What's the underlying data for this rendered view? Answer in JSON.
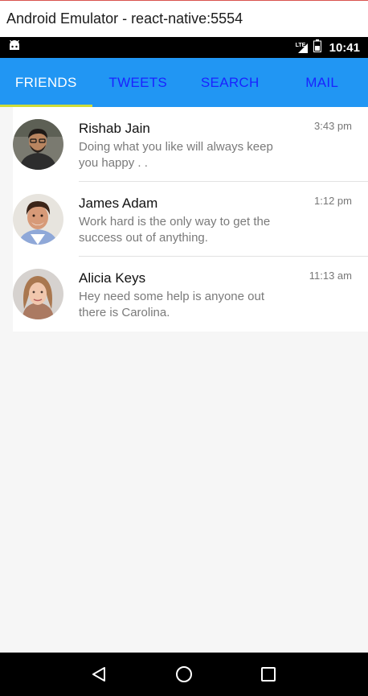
{
  "window": {
    "title": "Android Emulator - react-native:5554"
  },
  "status_bar": {
    "network": "LTE",
    "time": "10:41",
    "icons": [
      "android-debug-icon",
      "signal-icon",
      "battery-icon"
    ]
  },
  "tabs": [
    {
      "label": "FRIENDS",
      "active": true
    },
    {
      "label": "TWEETS",
      "active": false
    },
    {
      "label": "SEARCH",
      "active": false
    },
    {
      "label": "MAIL",
      "active": false
    }
  ],
  "colors": {
    "tabbar": "#2196f3",
    "active_indicator": "#cddc39",
    "inactive_tab_text": "#1a23ff"
  },
  "friends": [
    {
      "name": "Rishab Jain",
      "message": "Doing what you like will always keep you happy . .",
      "time": "3:43 pm"
    },
    {
      "name": "James Adam",
      "message": "Work hard is the only way to get the success out of anything.",
      "time": "1:12 pm"
    },
    {
      "name": "Alicia Keys",
      "message": "Hey need some help is anyone out there is Carolina.",
      "time": "11:13 am"
    }
  ],
  "nav": {
    "buttons": [
      "back-icon",
      "home-icon",
      "recents-icon"
    ]
  }
}
